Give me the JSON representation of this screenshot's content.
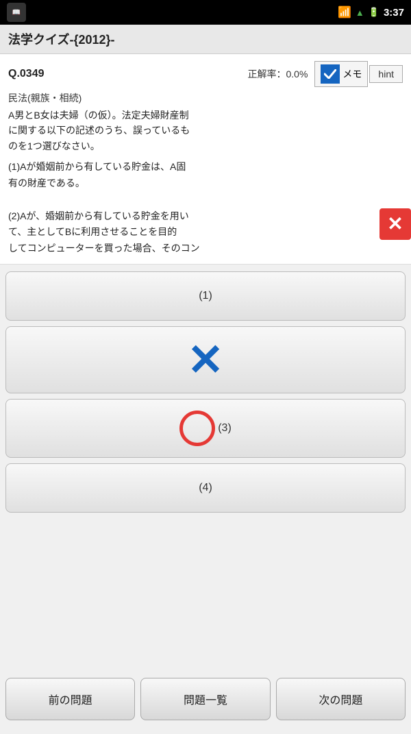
{
  "statusBar": {
    "time": "3:37",
    "signalColor": "#4caf50"
  },
  "titleBar": {
    "title": "法学クイズ-{2012}-"
  },
  "question": {
    "number": "Q.0349",
    "accuracyLabel": "正解率：0.0%",
    "memoLabel": "メモ",
    "hintLabel": "hint",
    "category": "民法(親族・相続)",
    "textLine1": "A男とB女は夫婦（の仮）。法定夫婦財産制",
    "textLine2": "に関する以下の記述のうち、誤っているも",
    "textLine3": "のを1つ選びなさい。",
    "choice1": "(1)Aが婚姻前から有している貯金は、A固",
    "choice1b": "有の財産である。",
    "choice2": "(2)Aが、婚姻前から有している貯金を用い",
    "choice2b": "て、主としてBに利用させることを目的",
    "choice2c": "してコンピューターを買った場合、そのコン"
  },
  "answers": {
    "btn1Label": "(1)",
    "btn2Label": "",
    "btn3Label": "(3)",
    "btn4Label": "(4)",
    "btn2IsWrong": true,
    "btn3IsCorrect": true
  },
  "navigation": {
    "prev": "前の問題",
    "list": "問題一覧",
    "next": "次の問題"
  }
}
